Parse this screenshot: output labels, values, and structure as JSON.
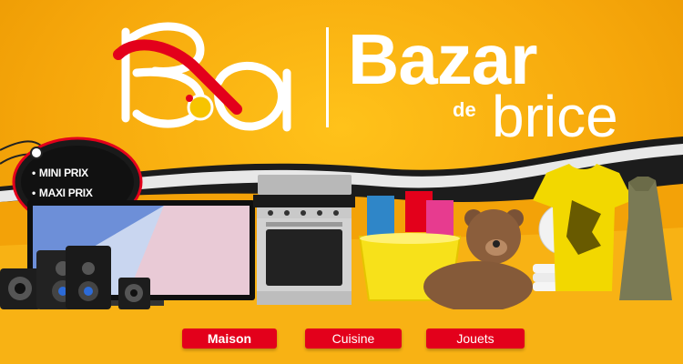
{
  "brand": {
    "title": "Bazar",
    "de": "de",
    "brice": "brice"
  },
  "tag": {
    "line1": "MINI PRIX",
    "line2": "MAXI PRIX"
  },
  "categories": [
    {
      "label": "Maison"
    },
    {
      "label": "Cuisine"
    },
    {
      "label": "Jouets"
    }
  ],
  "colors": {
    "background": "#f6a70b",
    "accent_red": "#e3001b",
    "wave_dark": "#1a1a1a",
    "text": "#ffffff"
  },
  "icons": [
    "logo-bb-icon",
    "price-tag-icon",
    "tv-icon",
    "speaker-icon",
    "stove-icon",
    "bucket-icon",
    "teddy-bear-icon",
    "plates-icon",
    "tshirt-icon",
    "dress-icon"
  ]
}
